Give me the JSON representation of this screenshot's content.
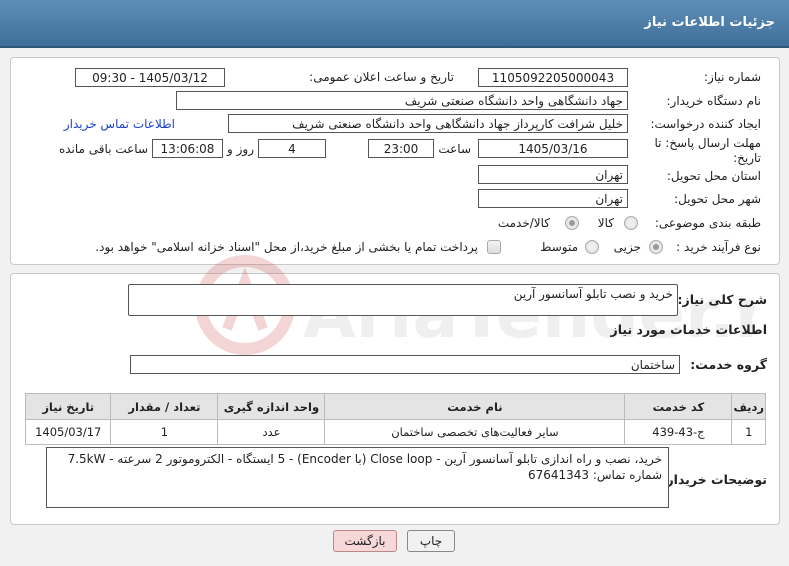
{
  "header": {
    "title": "جزئیات اطلاعات نیاز"
  },
  "form": {
    "need_number_label": "شماره نیاز:",
    "need_number": "1105092205000043",
    "announce_label": "تاریخ و ساعت اعلان عمومی:",
    "announce_value": "1405/03/12 - 09:30",
    "buyer_org_label": "نام دستگاه خریدار:",
    "buyer_org": "جهاد دانشگاهی واحد دانشگاه صنعتی شریف",
    "requester_label": "ایجاد کننده درخواست:",
    "requester": "خلیل شرافت کارپرداز جهاد دانشگاهی واحد دانشگاه صنعتی شریف",
    "contact_link": "اطلاعات تماس خریدار",
    "deadline_label_1": "مهلت ارسال پاسخ: تا",
    "deadline_label_2": "تاریخ:",
    "deadline_date": "1405/03/16",
    "time_label": "ساعت",
    "deadline_time": "23:00",
    "days_value": "4",
    "days_label": "روز و",
    "remaining_time": "13:06:08",
    "remaining_label": "ساعت باقی مانده",
    "province_label": "استان محل تحویل:",
    "province": "تهران",
    "city_label": "شهر محل تحویل:",
    "city": "تهران",
    "category_label": "طبقه بندی موضوعی:",
    "category_options": [
      "کالا",
      "کالا/خدمت"
    ],
    "process_label": "نوع فرآیند خرید :",
    "process_options": [
      "جزیی",
      "متوسط"
    ],
    "payment_note": "پرداخت تمام یا بخشی از مبلغ خرید،از محل \"اسناد خزانه اسلامی\" خواهد بود."
  },
  "summary": {
    "label": "شرح کلی نیاز:",
    "value": "خرید و نصب تابلو آسانسور آرین"
  },
  "services": {
    "section_title": "اطلاعات خدمات مورد نیاز",
    "group_label": "گروه خدمت:",
    "group_value": "ساختمان",
    "columns": [
      "ردیف",
      "کد خدمت",
      "نام خدمت",
      "واحد اندازه گیری",
      "تعداد / مقدار",
      "تاریخ نیاز"
    ],
    "rows": [
      [
        "1",
        "ج-43-439",
        "سایر فعالیت‌های تخصصی ساختمان",
        "عدد",
        "1",
        "1405/03/17"
      ]
    ]
  },
  "buyer_notes": {
    "label": "توضیحات خریدار:",
    "value": "خرید، نصب و راه اندازی تابلو آسانسور آرین - Close loop (با Encoder) - 5 ایستگاه - الکتروموتور 2 سرعته - 7.5kW\nشماره تماس: 67641343"
  },
  "buttons": {
    "print": "چاپ",
    "back": "بازگشت"
  },
  "watermark": {
    "text": "AriaTender.net"
  }
}
